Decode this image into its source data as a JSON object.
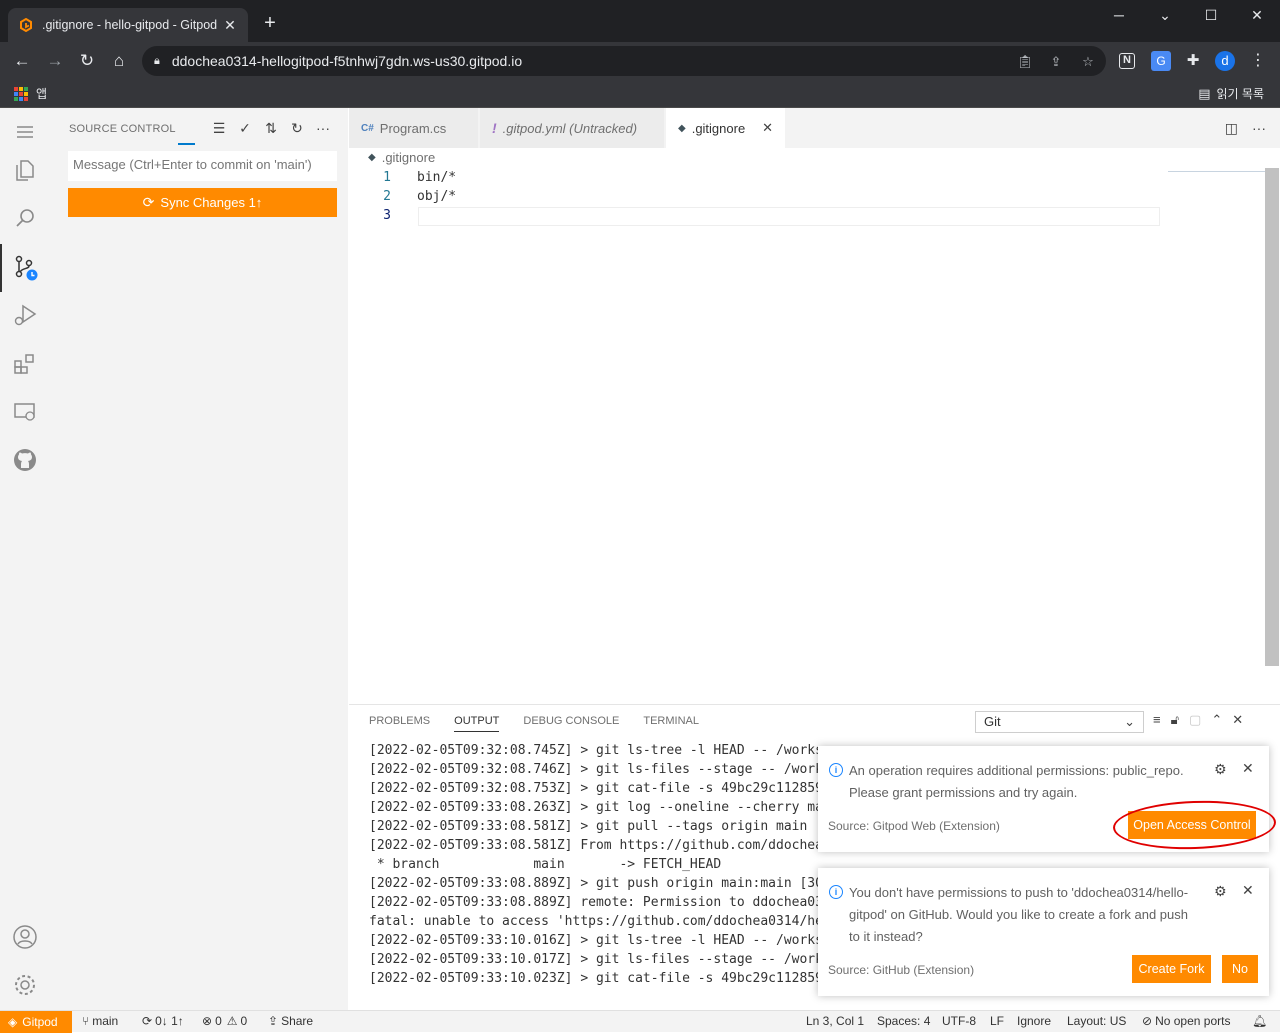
{
  "browser": {
    "tab_title": ".gitignore - hello-gitpod - Gitpod",
    "url": "ddochea0314-hellogitpod-f5tnhwj7gdn.ws-us30.gitpod.io",
    "bookmarks_apps_label": "앱",
    "reading_list_label": "읽기 목록",
    "profile_initial": "d"
  },
  "sidebar": {
    "title": "SOURCE CONTROL",
    "commit_placeholder": "Message (Ctrl+Enter to commit on 'main')",
    "sync_button": "Sync Changes 1↑"
  },
  "editor": {
    "tabs": [
      {
        "label": "Program.cs",
        "icon": "C#",
        "italic": false,
        "active": false
      },
      {
        "label": ".gitpod.yml (Untracked)",
        "icon": "!",
        "italic": true,
        "active": false
      },
      {
        "label": ".gitignore",
        "icon": "◆",
        "italic": false,
        "active": true
      }
    ],
    "breadcrumb": ".gitignore",
    "lines": [
      {
        "num": "1",
        "text": "bin/*"
      },
      {
        "num": "2",
        "text": "obj/*"
      },
      {
        "num": "3",
        "text": ""
      }
    ]
  },
  "panel": {
    "tabs": [
      "PROBLEMS",
      "OUTPUT",
      "DEBUG CONSOLE",
      "TERMINAL"
    ],
    "active_tab": "OUTPUT",
    "channel": "Git",
    "output_lines": [
      "[2022-02-05T09:32:08.745Z] > git ls-tree -l HEAD -- /works",
      "[2022-02-05T09:32:08.746Z] > git ls-files --stage -- /work",
      "[2022-02-05T09:32:08.753Z] > git cat-file -s 49bc29c112859",
      "[2022-02-05T09:33:08.263Z] > git log --oneline --cherry ma",
      "[2022-02-05T09:33:08.581Z] > git pull --tags origin main [",
      "[2022-02-05T09:33:08.581Z] From https://github.com/ddochea",
      " * branch            main       -> FETCH_HEAD",
      "[2022-02-05T09:33:08.889Z] > git push origin main:main [30",
      "[2022-02-05T09:33:08.889Z] remote: Permission to ddochea03",
      "fatal: unable to access 'https://github.com/ddochea0314/he",
      "[2022-02-05T09:33:10.016Z] > git ls-tree -l HEAD -- /works",
      "[2022-02-05T09:33:10.017Z] > git ls-files --stage -- /work",
      "[2022-02-05T09:33:10.023Z] > git cat-file -s 49bc29c112859"
    ]
  },
  "notifications": [
    {
      "text": "An operation requires additional permissions: public_repo. Please grant permissions and try again.",
      "source": "Source: Gitpod Web (Extension)",
      "buttons": [
        "Open Access Control"
      ]
    },
    {
      "text": "You don't have permissions to push to 'ddochea0314/hello-gitpod' on GitHub. Would you like to create a fork and push to it instead?",
      "source": "Source: GitHub (Extension)",
      "buttons": [
        "Create Fork",
        "No"
      ]
    }
  ],
  "statusbar": {
    "gitpod": "Gitpod",
    "branch": "main",
    "sync": "0↓ 1↑",
    "errors": "0",
    "warnings": "0",
    "share": "Share",
    "position": "Ln 3, Col 1",
    "spaces": "Spaces: 4",
    "encoding": "UTF-8",
    "eol": "LF",
    "ignore": "Ignore",
    "layout": "Layout: US",
    "ports": "No open ports"
  },
  "colors": {
    "accent": "#ff8a00",
    "focus_blue": "#007acc",
    "annotation_red": "#e00000"
  }
}
